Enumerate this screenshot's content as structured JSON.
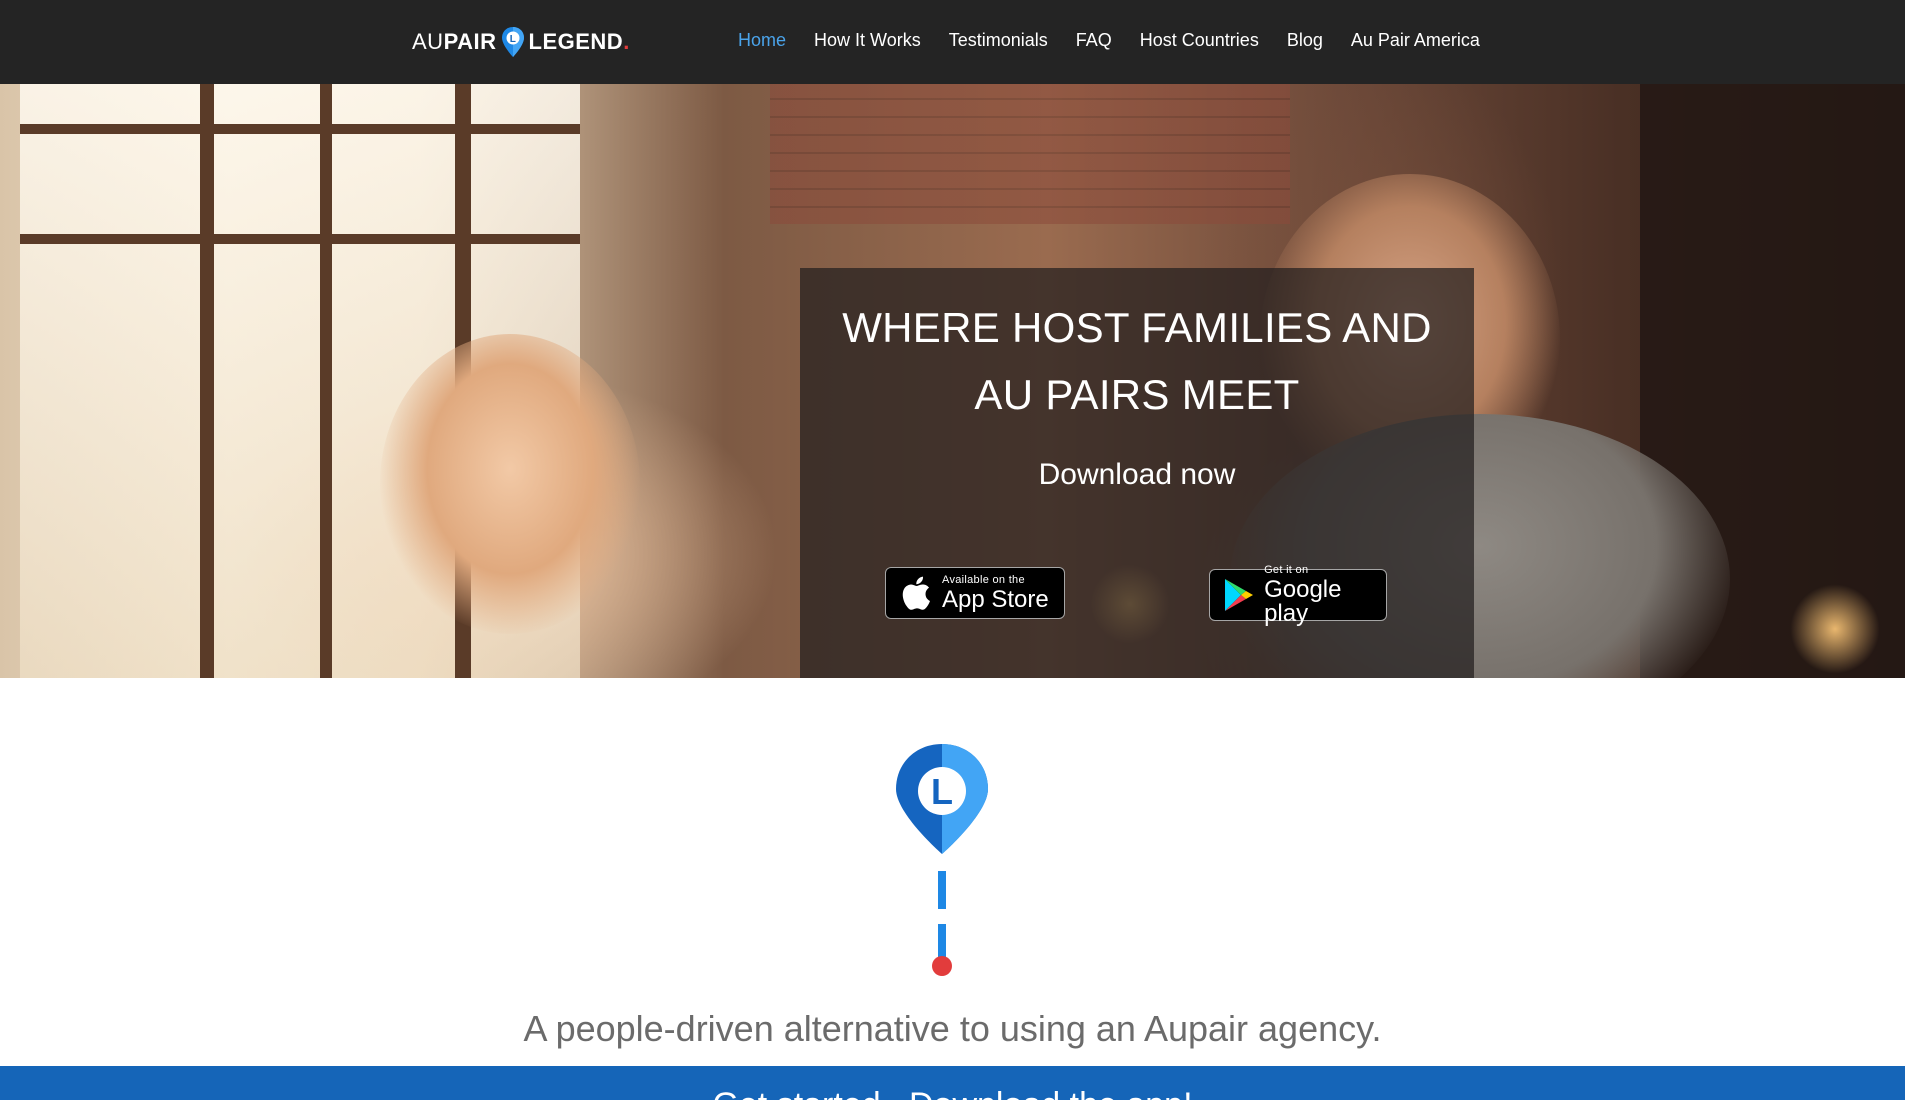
{
  "brand": {
    "logo_prefix": "AU",
    "logo_bold": "PAIR",
    "logo_suffix": "LEGEND",
    "logo_dot": ".",
    "logo_pin_letter": "L",
    "accent_color": "#4aa3ea",
    "pin_color": "#1e88e5",
    "dot_color": "#e23c3c"
  },
  "nav": {
    "items": [
      {
        "label": "Home",
        "active": true
      },
      {
        "label": "How It Works",
        "active": false
      },
      {
        "label": "Testimonials",
        "active": false
      },
      {
        "label": "FAQ",
        "active": false
      },
      {
        "label": "Host Countries",
        "active": false
      },
      {
        "label": "Blog",
        "active": false
      },
      {
        "label": "Au Pair America",
        "active": false
      }
    ]
  },
  "hero": {
    "title_line1": "WHERE HOST FAMILIES AND",
    "title_line2": "AU PAIRS MEET",
    "subtitle": "Download now",
    "app_store": {
      "small": "Available on the",
      "big": "App Store",
      "icon": "apple-icon"
    },
    "google_play": {
      "small": "Get it on",
      "big": "Google play",
      "icon": "google-play-icon"
    }
  },
  "section": {
    "pin_letter": "L",
    "tagline": "A people-driven alternative to using an Aupair agency.",
    "band_text": "Get started...Download the app!",
    "band_color": "#1565b8"
  }
}
